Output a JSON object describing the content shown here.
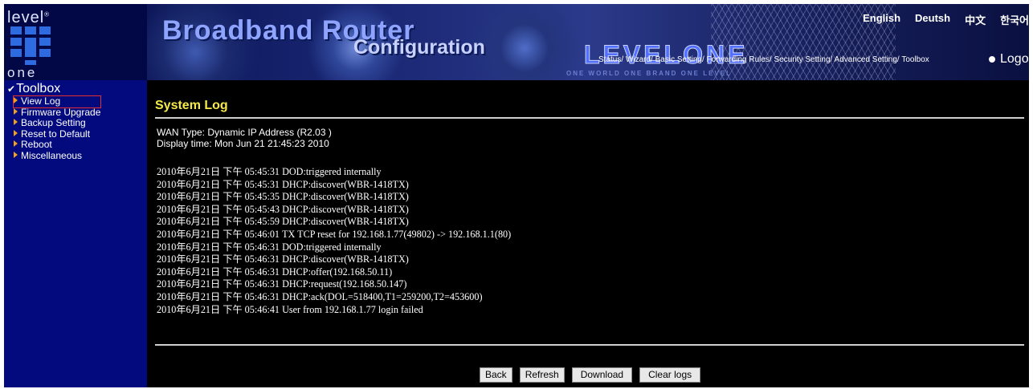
{
  "banner": {
    "logo_top": "level",
    "logo_bottom": "one",
    "title": "Broadband Router",
    "subtitle": "Configuration",
    "brand": "LEVELONE",
    "tagline": "ONE WORLD ONE BRAND ONE LEVEL",
    "languages": [
      "English",
      "Deutsh",
      "中文",
      "한국어"
    ],
    "nav": [
      "Status/",
      "Wizard/",
      "Basic Setting/",
      "Forwarding Rules/",
      "Security Setting/",
      "Advanced Setting/",
      "Toolbox"
    ],
    "logout": "Logout"
  },
  "sidebar": {
    "heading": "Toolbox",
    "items": [
      {
        "label": "View Log"
      },
      {
        "label": "Firmware Upgrade"
      },
      {
        "label": "Backup Setting"
      },
      {
        "label": "Reset to Default"
      },
      {
        "label": "Reboot"
      },
      {
        "label": "Miscellaneous"
      }
    ]
  },
  "main": {
    "title": "System Log",
    "wan_type": "WAN Type: Dynamic IP Address (R2.03 )",
    "display_time": "Display time: Mon Jun 21 21:45:23 2010",
    "log": [
      "2010年6月21日 下午 05:45:31 DOD:triggered internally",
      "2010年6月21日 下午 05:45:31 DHCP:discover(WBR-1418TX)",
      "2010年6月21日 下午 05:45:35 DHCP:discover(WBR-1418TX)",
      "2010年6月21日 下午 05:45:43 DHCP:discover(WBR-1418TX)",
      "2010年6月21日 下午 05:45:59 DHCP:discover(WBR-1418TX)",
      "2010年6月21日 下午 05:46:01 TX TCP reset for 192.168.1.77(49802) -> 192.168.1.1(80)",
      "2010年6月21日 下午 05:46:31 DOD:triggered internally",
      "2010年6月21日 下午 05:46:31 DHCP:discover(WBR-1418TX)",
      "2010年6月21日 下午 05:46:31 DHCP:offer(192.168.50.11)",
      "2010年6月21日 下午 05:46:31 DHCP:request(192.168.50.147)",
      "2010年6月21日 下午 05:46:31 DHCP:ack(DOL=518400,T1=259200,T2=453600)",
      "2010年6月21日 下午 05:46:41 User from 192.168.1.77 login failed"
    ],
    "buttons": {
      "back": "Back",
      "refresh": "Refresh",
      "download": "Download",
      "clear": "Clear logs"
    }
  }
}
